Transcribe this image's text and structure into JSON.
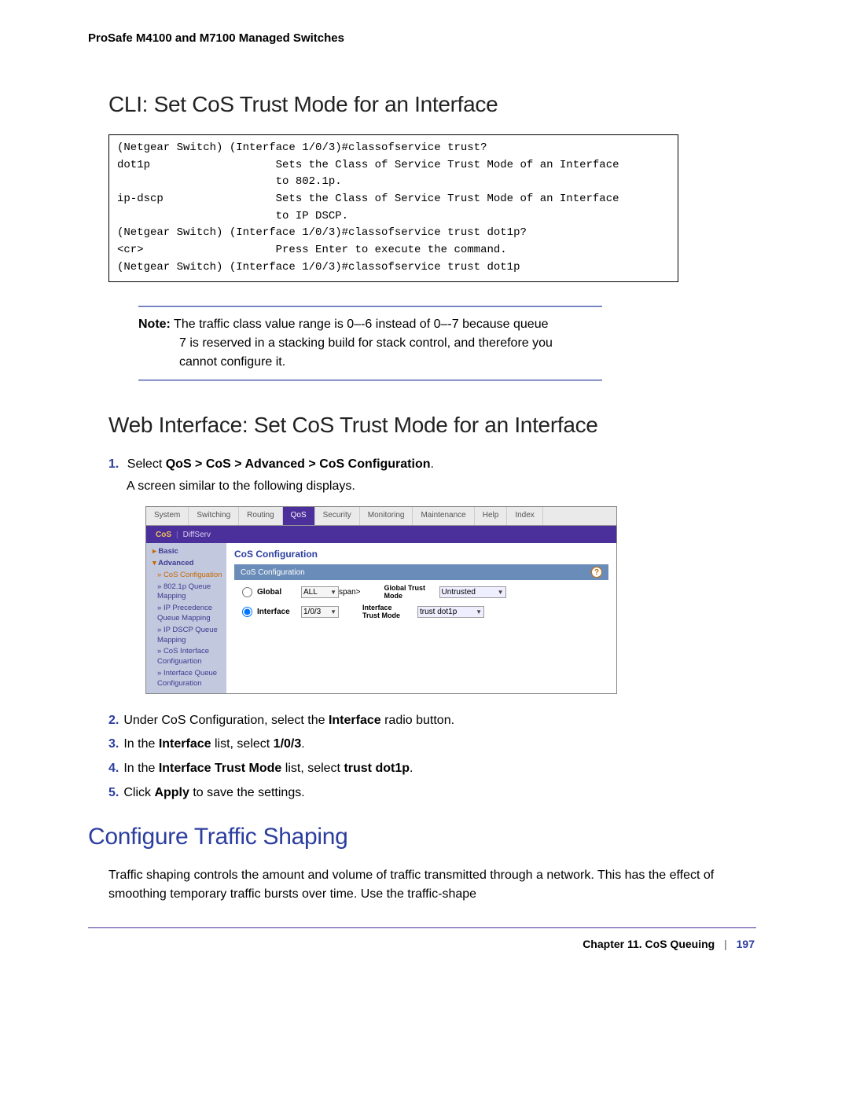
{
  "header": "ProSafe M4100 and M7100 Managed Switches",
  "section1_title": "CLI: Set CoS Trust Mode for an Interface",
  "cli": "(Netgear Switch) (Interface 1/0/3)#classofservice trust?\ndot1p                   Sets the Class of Service Trust Mode of an Interface\n                        to 802.1p.\nip-dscp                 Sets the Class of Service Trust Mode of an Interface\n                        to IP DSCP.\n(Netgear Switch) (Interface 1/0/3)#classofservice trust dot1p?\n<cr>                    Press Enter to execute the command.\n(Netgear Switch) (Interface 1/0/3)#classofservice trust dot1p",
  "note": {
    "label": "Note:",
    "line1": "The traffic class value range is 0–-6 instead of 0–-7 because queue",
    "line2": "7 is reserved in a stacking build for stack control, and therefore you",
    "line3": "cannot configure it."
  },
  "section2_title": "Web Interface: Set CoS Trust Mode for an Interface",
  "steps_a": {
    "n1": "1.",
    "t1a": "Select ",
    "t1b": "QoS > CoS > Advanced > CoS Configuration",
    "t1c": ".",
    "sub1": "A screen similar to the following displays."
  },
  "ui": {
    "tabs": [
      "System",
      "Switching",
      "Routing",
      "QoS",
      "Security",
      "Monitoring",
      "Maintenance",
      "Help",
      "Index"
    ],
    "subtabs": {
      "active": "CoS",
      "other": "DiffServ"
    },
    "sidebar": {
      "basic": "Basic",
      "advanced": "Advanced",
      "items": [
        "CoS Configuation",
        "802.1p Queue Mapping",
        "IP Precedence Queue Mapping",
        "IP DSCP Queue Mapping",
        "CoS Interface Configuartion",
        "Interface Queue Configuration"
      ]
    },
    "panel_title": "CoS Configuration",
    "panel_header": "CoS Configuration",
    "row1": {
      "radio": "Global",
      "sel": "ALL",
      "lbl2a": "Global Trust",
      "lbl2b": "Mode",
      "val": "Untrusted"
    },
    "row2": {
      "radio": "Interface",
      "sel": "1/0/3",
      "lbl2a": "Interface",
      "lbl2b": "Trust Mode",
      "val": "trust dot1p"
    }
  },
  "steps_b": {
    "n2": "2.",
    "t2a": "Under CoS Configuration, select the ",
    "t2b": "Interface",
    "t2c": " radio button.",
    "n3": "3.",
    "t3a": "In the ",
    "t3b": "Interface",
    "t3c": " list, select ",
    "t3d": "1/0/3",
    "t3e": ".",
    "n4": "4.",
    "t4a": "In the ",
    "t4b": "Interface Trust Mode",
    "t4c": " list, select ",
    "t4d": "trust dot1p",
    "t4e": ".",
    "n5": "5.",
    "t5a": "Click ",
    "t5b": "Apply",
    "t5c": " to save the settings."
  },
  "section3_title": "Configure Traffic Shaping",
  "para3": "Traffic shaping controls the amount and volume of traffic transmitted through a network. This has the effect of smoothing temporary traffic bursts over time. Use the traffic-shape",
  "footer": {
    "chapter": "Chapter 11.  CoS Queuing",
    "page": "197"
  }
}
